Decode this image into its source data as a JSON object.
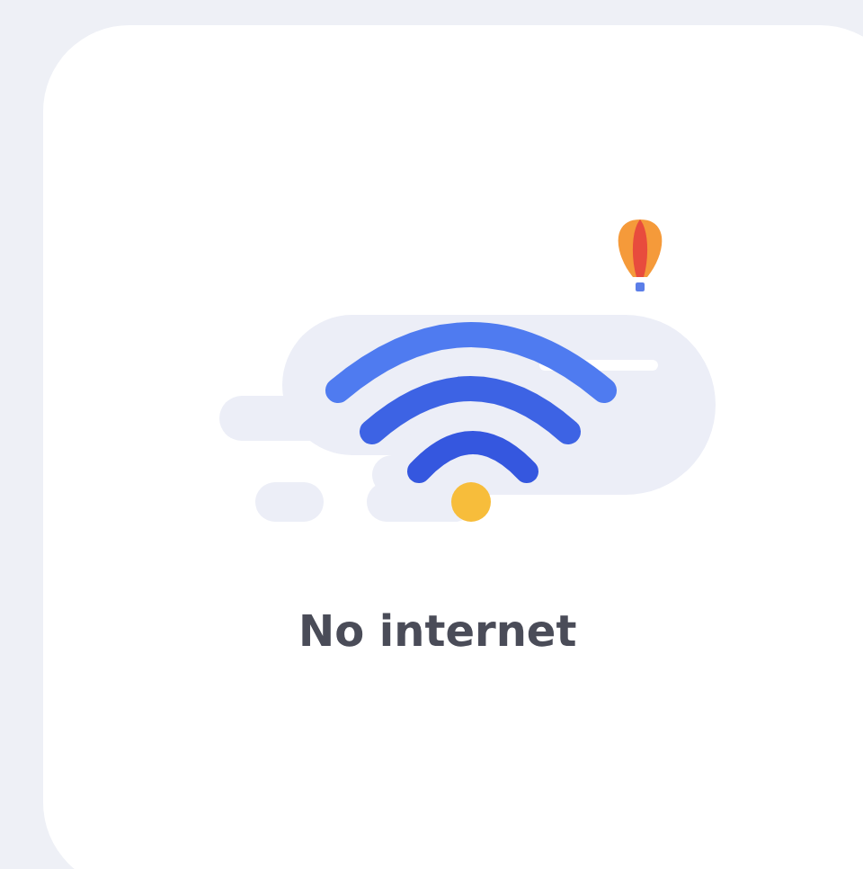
{
  "card": {
    "message": "No internet"
  }
}
